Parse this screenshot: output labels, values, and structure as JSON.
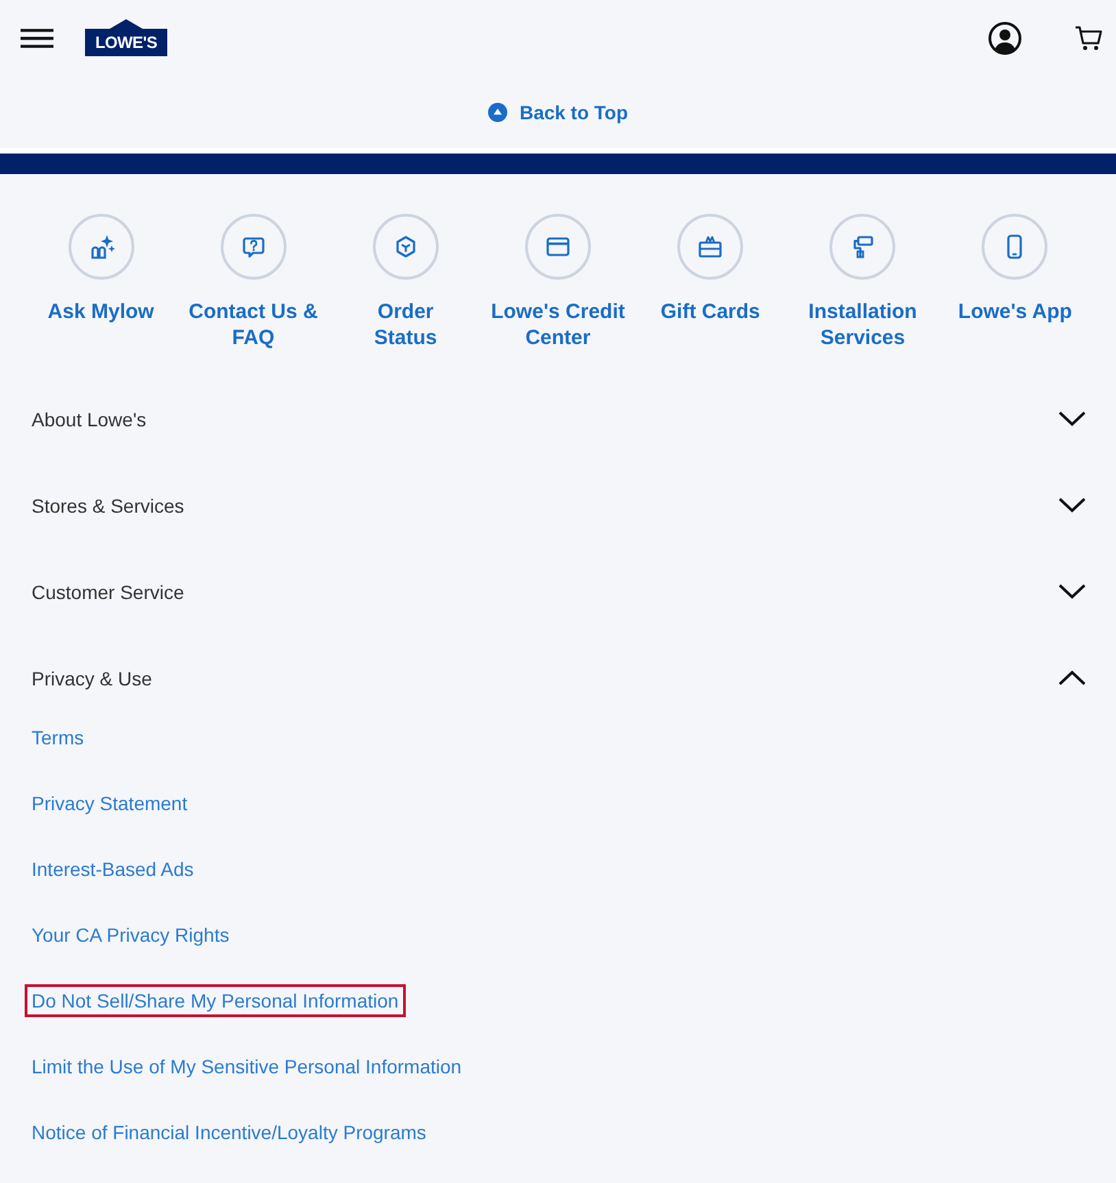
{
  "header": {
    "logo": "LOWE'S"
  },
  "back_to_top": {
    "label": "Back to Top"
  },
  "quick_links": [
    {
      "kind": "assistant",
      "label": "Ask Mylow"
    },
    {
      "kind": "help",
      "label": "Contact Us &\nFAQ"
    },
    {
      "kind": "order",
      "label": "Order\nStatus"
    },
    {
      "kind": "credit",
      "label": "Lowe's Credit\nCenter"
    },
    {
      "kind": "gift",
      "label": "Gift Cards"
    },
    {
      "kind": "install",
      "label": "Installation\nServices"
    },
    {
      "kind": "app",
      "label": "Lowe's App"
    }
  ],
  "footer_sections": [
    {
      "label": "About Lowe's",
      "expanded": false
    },
    {
      "label": "Stores & Services",
      "expanded": false
    },
    {
      "label": "Customer Service",
      "expanded": false
    },
    {
      "label": "Privacy & Use",
      "expanded": true,
      "links": [
        {
          "label": "Terms",
          "highlighted": false
        },
        {
          "label": "Privacy Statement",
          "highlighted": false
        },
        {
          "label": "Interest-Based Ads",
          "highlighted": false
        },
        {
          "label": "Your CA Privacy Rights",
          "highlighted": false
        },
        {
          "label": "Do Not Sell/Share My Personal Information",
          "highlighted": true
        },
        {
          "label": "Limit the Use of My Sensitive Personal Information",
          "highlighted": false
        },
        {
          "label": "Notice of Financial Incentive/Loyalty Programs",
          "highlighted": false
        }
      ]
    }
  ]
}
